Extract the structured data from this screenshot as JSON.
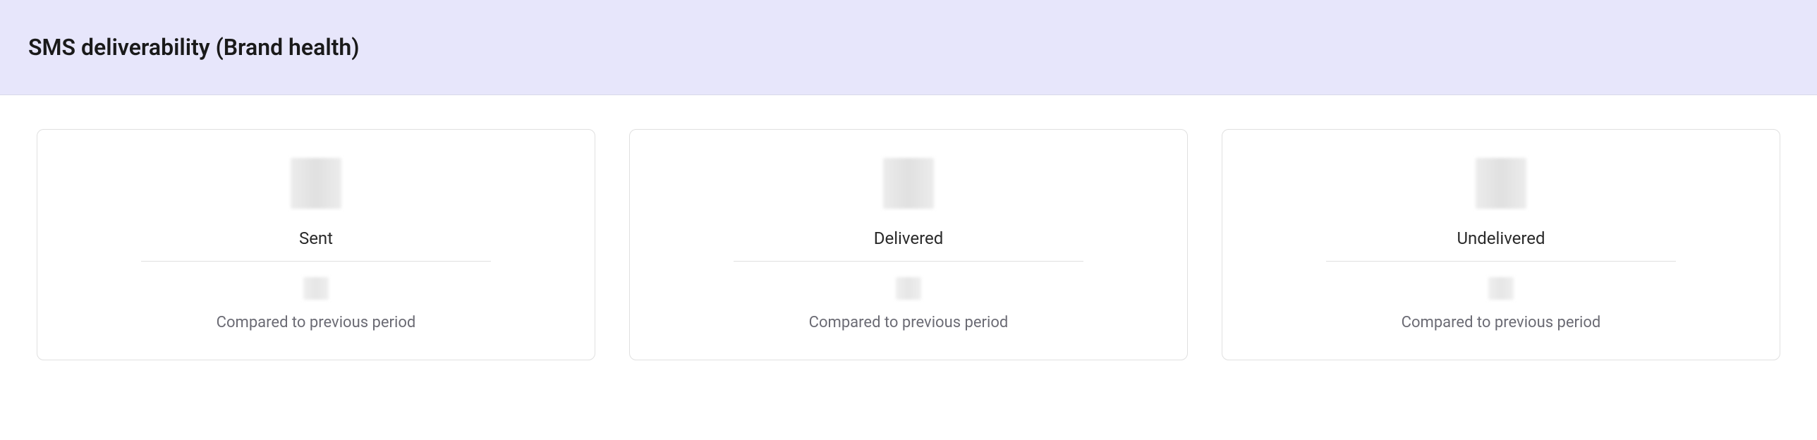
{
  "header": {
    "title": "SMS deliverability (Brand health)"
  },
  "cards": [
    {
      "label": "Sent",
      "comparison": "Compared to previous period"
    },
    {
      "label": "Delivered",
      "comparison": "Compared to previous period"
    },
    {
      "label": "Undelivered",
      "comparison": "Compared to previous period"
    }
  ]
}
